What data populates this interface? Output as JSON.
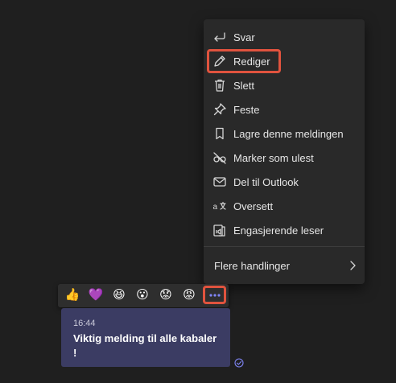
{
  "menu": {
    "items": [
      {
        "label": "Svar",
        "icon": "reply-icon"
      },
      {
        "label": "Rediger",
        "icon": "pencil-icon"
      },
      {
        "label": "Slett",
        "icon": "trash-icon"
      },
      {
        "label": "Feste",
        "icon": "pin-icon"
      },
      {
        "label": "Lagre denne meldingen",
        "icon": "bookmark-icon"
      },
      {
        "label": "Marker som ulest",
        "icon": "hidden-eye-icon"
      },
      {
        "label": "Del til Outlook",
        "icon": "mail-icon"
      },
      {
        "label": "Oversett",
        "icon": "translate-icon"
      },
      {
        "label": "Engasjerende leser",
        "icon": "immersive-reader-icon"
      }
    ],
    "more_actions": "Flere handlinger"
  },
  "reactions": [
    {
      "name": "like",
      "glyph": "👍"
    },
    {
      "name": "heart",
      "glyph": "💜"
    },
    {
      "name": "laugh",
      "glyph": "😆"
    },
    {
      "name": "surprised",
      "glyph": "😮"
    },
    {
      "name": "sad",
      "glyph": "😟"
    },
    {
      "name": "angry",
      "glyph": "😡"
    }
  ],
  "message": {
    "time": "16:44",
    "text": "Viktig melding til alle kabaler !"
  },
  "colors": {
    "highlight": "#e0533e",
    "bubble": "#3b3c63",
    "menu_bg": "#292929",
    "accent": "#7f85f5"
  }
}
